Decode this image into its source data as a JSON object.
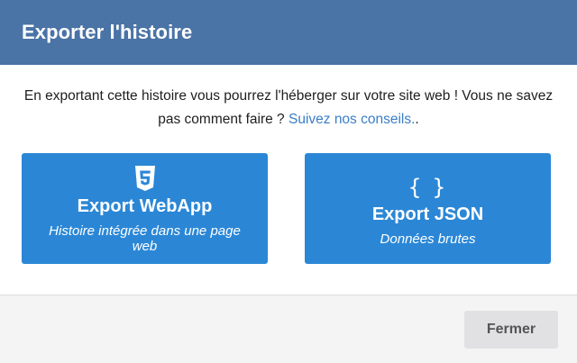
{
  "dialog": {
    "title": "Exporter l'histoire",
    "intro_text": "En exportant cette histoire vous pourrez l'héberger sur votre site web ! Vous ne savez pas comment faire ? ",
    "intro_link": "Suivez nos conseils.",
    "intro_after": ".",
    "link_color": "#3a7ec8",
    "header_color": "#4a73a6",
    "button_color": "#2b87d6"
  },
  "export_options": [
    {
      "icon": "html5-icon",
      "title": "Export WebApp",
      "subtitle": "Histoire intégrée dans une page web"
    },
    {
      "icon": "braces-icon",
      "icon_text": "{ }",
      "title": "Export JSON",
      "subtitle": "Données brutes"
    }
  ],
  "footer": {
    "close_label": "Fermer"
  }
}
